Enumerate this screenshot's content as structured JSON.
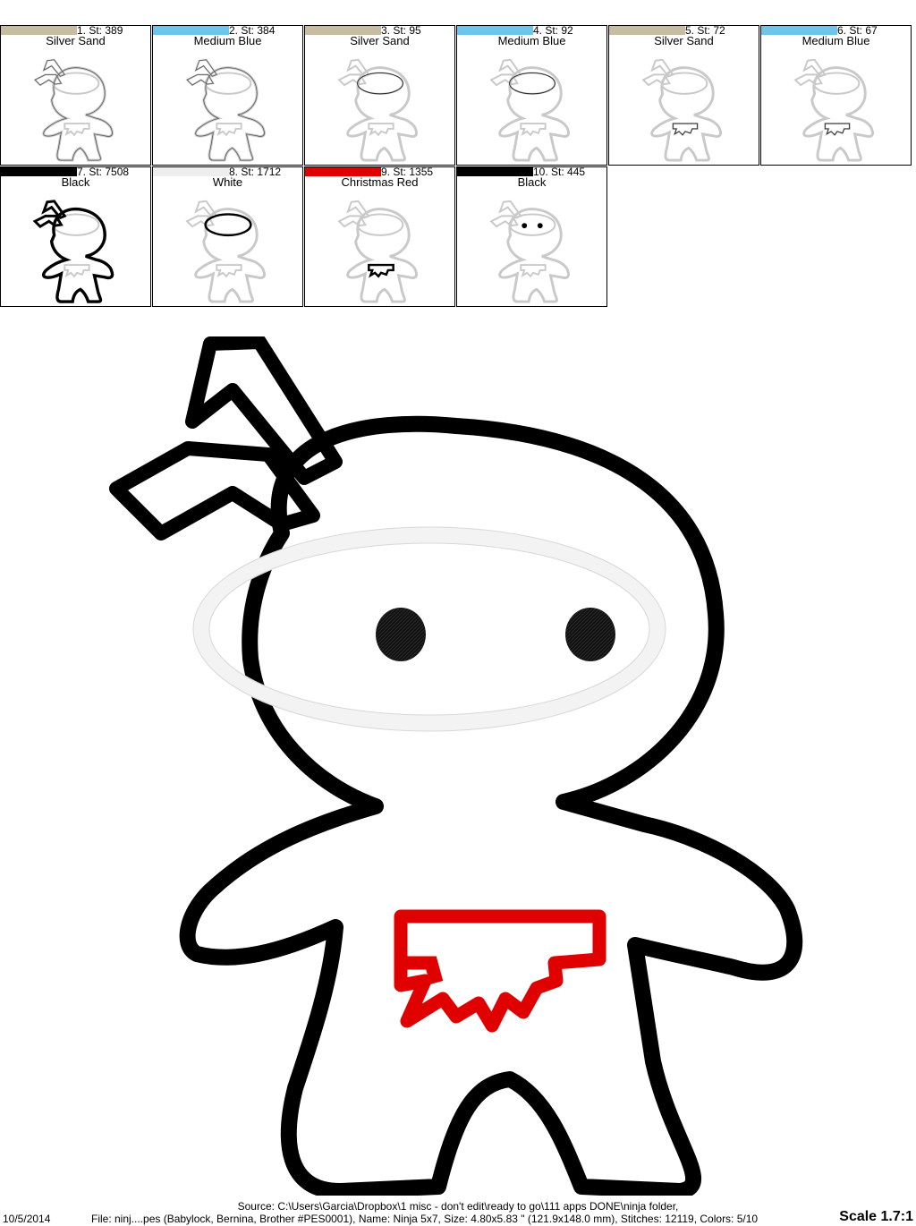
{
  "colors": {
    "silver_sand": "#c7bba2",
    "medium_blue": "#6fc4ec",
    "black": "#000000",
    "white": "#f2f2f2",
    "christmas_red": "#e00000"
  },
  "thread_steps": [
    {
      "number_label": "1. St: 389",
      "color_name": "Silver Sand",
      "swatch": "#c7bba2",
      "highlight": "outline"
    },
    {
      "number_label": "2. St: 384",
      "color_name": "Medium Blue",
      "swatch": "#6fc4ec",
      "highlight": "outline"
    },
    {
      "number_label": "3. St: 95",
      "color_name": "Silver Sand",
      "swatch": "#c7bba2",
      "highlight": "mask"
    },
    {
      "number_label": "4. St: 92",
      "color_name": "Medium Blue",
      "swatch": "#6fc4ec",
      "highlight": "mask"
    },
    {
      "number_label": "5. St: 72",
      "color_name": "Silver Sand",
      "swatch": "#c7bba2",
      "highlight": "belt"
    },
    {
      "number_label": "6. St: 67",
      "color_name": "Medium Blue",
      "swatch": "#6fc4ec",
      "highlight": "belt"
    },
    {
      "number_label": "7. St: 7508",
      "color_name": "Black",
      "swatch": "#000000",
      "highlight": "outline-bold"
    },
    {
      "number_label": "8. St: 1712",
      "color_name": "White",
      "swatch": "#f2f2f2",
      "highlight": "mask-bold"
    },
    {
      "number_label": "9. St: 1355",
      "color_name": "Christmas Red",
      "swatch": "#e00000",
      "highlight": "belt-bold"
    },
    {
      "number_label": "10. St: 445",
      "color_name": "Black",
      "swatch": "#000000",
      "highlight": "eyes"
    }
  ],
  "footer": {
    "date": "10/5/2014",
    "source": "Source: C:\\Users\\Garcia\\Dropbox\\1 misc - don't edit\\ready to go\\111 apps DONE\\ninja folder,",
    "file_info": "File: ninj....pes (Babylock, Bernina, Brother #PES0001), Name: Ninja 5x7, Size: 4.80x5.83 \" (121.9x148.0 mm), Stitches: 12119, Colors: 5/10",
    "scale": "Scale 1.7:1"
  }
}
